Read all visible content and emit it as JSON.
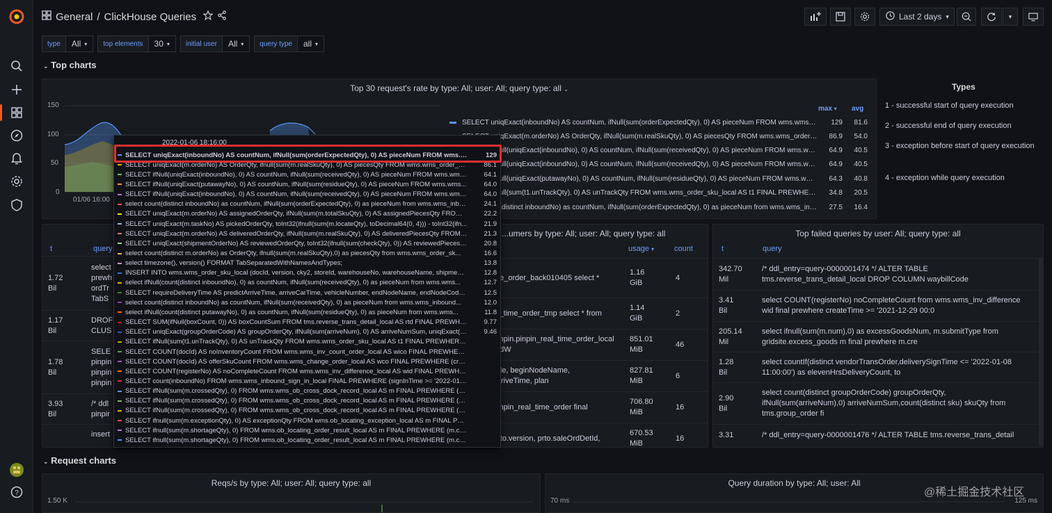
{
  "header": {
    "breadcrumb_folder": "General",
    "breadcrumb_sep": "/",
    "dashboard_title": "ClickHouse Queries",
    "time_range": "Last 2 days"
  },
  "variables": [
    {
      "label": "type",
      "value": "All"
    },
    {
      "label": "top elements",
      "value": "30"
    },
    {
      "label": "initial user",
      "value": "All"
    },
    {
      "label": "query type",
      "value": "all"
    }
  ],
  "rows": {
    "top_charts": "Top charts",
    "request_charts": "Request charts"
  },
  "top_panel": {
    "title": "Top 30 request's rate by type: All; user: All; query type: all",
    "y_ticks": [
      "150",
      "100",
      "50",
      "0"
    ],
    "x_tick": "01/06 16:00",
    "legend_max": "max",
    "legend_avg": "avg",
    "legend": [
      {
        "q": "SELECT uniqExact(inboundNo) AS countNum, ifNull(sum(orderExpectedQty), 0) AS pieceNum FROM wms.wms_inbo...",
        "max": "129",
        "avg": "81.6",
        "color": "#5794f2"
      },
      {
        "q": "SELECT uniqExact(m.orderNo) AS OrderQty, ifNull(sum(m.realSkuQty), 0) AS piecesQty FROM wms.wms_order_sku_l...",
        "max": "86.9",
        "avg": "54.0",
        "color": "#e0b400"
      },
      {
        "q": "SELECT ifNull(uniqExact(inboundNo), 0) AS countNum, ifNull(sum(receivedQty), 0) AS pieceNum FROM wms.wms_inbound_or...",
        "max": "64.9",
        "avg": "40.5",
        "color": "#73bf69"
      },
      {
        "q": "SELECT ifNull(uniqExact(inboundNo), 0) AS countNum, ifNull(sum(receivedQty), 0) AS pieceNum FROM wms.wms_re...",
        "max": "64.9",
        "avg": "40.5",
        "color": "#b877d9"
      },
      {
        "q": "SELECT ifNull(uniqExact(putawayNo), 0) AS countNum, ifNull(sum(residueQty), 0) AS pieceNum FROM wms.wms...",
        "max": "64.3",
        "avg": "40.8",
        "color": "#ff9830"
      },
      {
        "q": "SELECT ifNull(sum(t1.unTrackQty), 0) AS unTrackQty FROM wms.wms_order_sku_local AS t1 FINAL PREWHERE (t1.s...",
        "max": "34.8",
        "avg": "20.5",
        "color": "#f2495c"
      },
      {
        "q": "select count(distinct inboundNo) as countNum, ifNull(sum(orderExpectedQty), 0) as pieceNum from wms.wms_inbo...",
        "max": "27.5",
        "avg": "16.4",
        "color": "#8ab8ff"
      }
    ]
  },
  "types_panel": {
    "title": "Types",
    "items": [
      "1 - successful start of query execution",
      "2 - successful end of query execution",
      "3 - exception before start of query execution",
      "4 - exception while query execution"
    ]
  },
  "tooltip": {
    "time": "2022-01-06 18:16:00",
    "rows": [
      {
        "q": "SELECT uniqExact(inboundNo) AS countNum, ifNull(sum(orderExpectedQty), 0) AS pieceNum FROM wms.wms_in...",
        "v": "129",
        "color": "#5794f2"
      },
      {
        "q": "SELECT uniqExact(m.orderNo) AS OrderQty, ifnull(sum(m.realSkuQty), 0) AS piecesQty FROM wms.wms_order_sku...",
        "v": "86.1",
        "color": "#e0b400"
      },
      {
        "q": "SELECT ifNull(uniqExact(inboundNo), 0) AS countNum, ifNull(sum(receivedQty), 0) AS pieceNum FROM wms.wms...",
        "v": "64.1",
        "color": "#73bf69"
      },
      {
        "q": "SELECT ifNull(uniqExact(putawayNo), 0) AS countNum, ifNull(sum(residueQty), 0) AS pieceNum FROM wms.wms...",
        "v": "64.0",
        "color": "#ff9830"
      },
      {
        "q": "SELECT ifNull(uniqExact(inboundNo), 0) AS countNum, ifNull(sum(receivedQty), 0) AS pieceNum FROM wms.wms_inbound...",
        "v": "64.0",
        "color": "#b877d9"
      },
      {
        "q": "select count(distinct inboundNo) as countNum, ifNull(sum(orderExpectedQty), 0) as pieceNum from wms.wms_inbo...",
        "v": "24.1",
        "color": "#f2495c"
      },
      {
        "q": "SELECT uniqExact(m.orderNo) AS assignedOrderQty, ifNull(sum(m.totalSkuQty), 0) AS assignedPiecesQty FROM w...",
        "v": "22.2",
        "color": "#fade2a"
      },
      {
        "q": "SELECT uniqExact(m.taskNo) AS pickedOrderQty, toInt32(ifnull(sum(m.locateQty), toDecimal64(0, 4))) - toInt32(ifn...",
        "v": "21.9",
        "color": "#8ab8ff"
      },
      {
        "q": "SELECT uniqExact(m.orderNo) AS deliveredOrderQty, ifNull(sum(m.realSkuQty), 0) AS deliveredPiecesQty FROM w...",
        "v": "21.3",
        "color": "#ff7383"
      },
      {
        "q": "SELECT uniqExact(shipmentOrderNo) AS reviewedOrderQty, toInt32(ifnull(sum(checkQty), 0)) AS reviewedPiecesQ...",
        "v": "20.8",
        "color": "#96d98d"
      },
      {
        "q": "select count(distinct m.orderNo) as OrderQty, ifnull(sum(m.realSkuQty),0) as piecesQty from wms.wms_order_sk...",
        "v": "16.6",
        "color": "#ffb357"
      },
      {
        "q": "select timezone(), version() FORMAT TabSeparatedWithNamesAndTypes;",
        "v": "13.8",
        "color": "#ca95e5"
      },
      {
        "q": "INSERT INTO wms.wms_order_sku_local (docId, version, cky2, storeId, warehouseNo, warehouseName, shipmentO...",
        "v": "12.8",
        "color": "#3274d9"
      },
      {
        "q": "select ifNull(count(distinct inboundNo), 0) as countNum, ifNull(sum(receivedQty), 0) as pieceNum from wms.wms...",
        "v": "12.7",
        "color": "#e0b400"
      },
      {
        "q": "SELECT requireDeliveryTime AS predictArriveTime, arriveCarTime, vehicleNumber, endNodeName, endNodeCode, ...",
        "v": "12.5",
        "color": "#37872d"
      },
      {
        "q": "select count(distinct inboundNo) as countNum, ifNull(sum(receivedQty), 0) as pieceNum from wms.wms_inbound...",
        "v": "12.0",
        "color": "#8f3bb8"
      },
      {
        "q": "select ifNull(count(distinct putawayNo), 0) as countNum, ifNull(sum(residueQty), 0) as pieceNum from wms.wms...",
        "v": "11.8",
        "color": "#fa6400"
      },
      {
        "q": "SELECT SUM(ifNull(boxCount, 0)) AS boxCountSum FROM tms.reverse_trans_detail_local AS rtd FINAL PREWHERE ...",
        "v": "9.77",
        "color": "#c4162a"
      },
      {
        "q": "SELECT uniqExact(groupOrderCode) AS groupOrderQty, ifNull(sum(arriveNum), 0) AS arriveNumSum, uniqExact(sk...",
        "v": "9.46",
        "color": "#1f60c4"
      },
      {
        "q": "SELECT ifNull(sum(t1.unTrackQty), 0) AS unTrackQty FROM wms.wms_order_sku_local AS t1 FINAL PREWHERE (t1...",
        "v": "",
        "color": "#cc9d00"
      },
      {
        "q": "SELECT COUNT(docId) AS noInventoryCount FROM wms.wms_inv_count_order_local AS wico FINAL PREWHERE (...",
        "v": "",
        "color": "#56a64b"
      },
      {
        "q": "SELECT COUNT(docId) AS offerSkuCount FROM wms.wms_change_order_local AS wco FINAL PREWHERE (create...",
        "v": "",
        "color": "#a352cc"
      },
      {
        "q": "SELECT COUNT(registerNo) AS noCompleteCount FROM wms.wms_inv_difference_local AS wid FINAL PREWHERE ...",
        "v": "",
        "color": "#ff780a"
      },
      {
        "q": "SELECT count(inboundNo) FROM wms.wms_inbound_sign_in_local FINAL PREWHERE (signInTime >= '2022-01-07 ...",
        "v": "",
        "color": "#e02f44"
      },
      {
        "q": "SELECT ifNull(sum(m.crossedQty), 0) FROM wms.wms_ob_cross_dock_record_local AS m FINAL PREWHERE (m.c...",
        "v": "",
        "color": "#5794f2"
      },
      {
        "q": "SELECT ifNull(sum(m.crossedQty), 0) FROM wms.wms_ob_cross_dock_record_local AS m FINAL PREWHERE (m.cr...",
        "v": "",
        "color": "#73bf69"
      },
      {
        "q": "SELECT ifNull(sum(m.crossedQty), 0) FROM wms.wms_ob_cross_dock_record_local AS m FINAL PREWHERE (m.c...",
        "v": "",
        "color": "#e0b400"
      },
      {
        "q": "SELECT ifnull(sum(m.exceptionQty), 0) AS exceptionQty FROM wms.ob_locating_exception_local AS m FINAL PRE...",
        "v": "",
        "color": "#f2495c"
      },
      {
        "q": "SELECT ifnull(sum(m.shortageQty), 0) FROM wms.ob_locating_order_result_local AS m FINAL PREWHERE (m.crea...",
        "v": "",
        "color": "#b877d9"
      },
      {
        "q": "SELECT ifnull(sum(m.shortageQty), 0) FROM wms.ob_locating_order_result_local AS m FINAL PREWHERE (m.creat...",
        "v": "",
        "color": "#5794f2"
      }
    ]
  },
  "left_table": {
    "col_t": "t",
    "col_query": "query",
    "rows": [
      {
        "t": "1.72\nBil",
        "q": "select\nprewh\nordTr\nTabS"
      },
      {
        "t": "1.17\nBil",
        "q": "DROF\nCLUS"
      },
      {
        "t": "1.78\nBil",
        "q": "SELE\npinpin\npinpin\npinpin"
      },
      {
        "t": "3.93\nBil",
        "q": "/* ddl\npinpir"
      },
      {
        "t": "",
        "q": "insert"
      }
    ]
  },
  "mid_table": {
    "title": "...umers by type: All; user: All; query type: all",
    "col_usage": "usage",
    "col_count": "count",
    "rows": [
      {
        "q": "me_order_back010405 select *",
        "usage": "1.16\nGiB",
        "count": "4"
      },
      {
        "q": "al_time_order_tmp select * from",
        "usage": "1.14\nGiB",
        "count": "2"
      },
      {
        "q": "pinpin.pinpin_real_time_order_local\ntedW",
        "usage": "851.01\nMiB",
        "count": "46"
      },
      {
        "q": "ode, beginNodeName,\nArriveTime, plan",
        "usage": "827.81\nMiB",
        "count": "6"
      },
      {
        "q": "pinpin_real_time_order final",
        "usage": "706.80\nMiB",
        "count": "16"
      },
      {
        "q": "orto.version, prto.saleOrdDetId,",
        "usage": "670.53\nMiB",
        "count": "16"
      }
    ]
  },
  "failed_table": {
    "title": "Top failed queries by user: All; query type: all",
    "col_t": "t",
    "col_query": "query",
    "rows": [
      {
        "t": "342.70\nMil",
        "q": "/* ddl_entry=query-0000001474 */ ALTER TABLE\ntms.reverse_trans_detail_local DROP COLUMN waybillCode"
      },
      {
        "t": "3.41\nBil",
        "q": "select COUNT(registerNo) noCompleteCount from wms.wms_inv_difference\nwid final prewhere createTime >= '2021-12-29 00:0"
      },
      {
        "t": "205.14\nMil",
        "q": "select ifnull(sum(m.num),0) as excessGoodsNum, m.submitType from\ngridsite.excess_goods m final prewhere m.cre"
      },
      {
        "t": "1.28\nBil",
        "q": "select countIf(distinct vendorTransOrder,deliverySignTime <= '2022-01-08\n11:00:00') as elevenHrsDeliveryCount, to"
      },
      {
        "t": "2.90\nBil",
        "q": "select count(distinct groupOrderCode) groupOrderQty,\nifNull(sum(arriveNum),0) arriveNumSum,count(distinct sku) skuQty from\ntms.group_order fi"
      },
      {
        "t": "3.31",
        "q": "/* ddl_entry=query-0000001476 */ ALTER TABLE tms.reverse_trans_detail"
      }
    ]
  },
  "bottom_left": {
    "title": "Reqs/s by type: All; user: All; query type: all",
    "y_tick": "1.50 K"
  },
  "bottom_right": {
    "title": "Query duration by type: All; user: All",
    "y_left": "70 ms",
    "y_right": "125 ms"
  },
  "watermark": "@稀土掘金技术社区"
}
